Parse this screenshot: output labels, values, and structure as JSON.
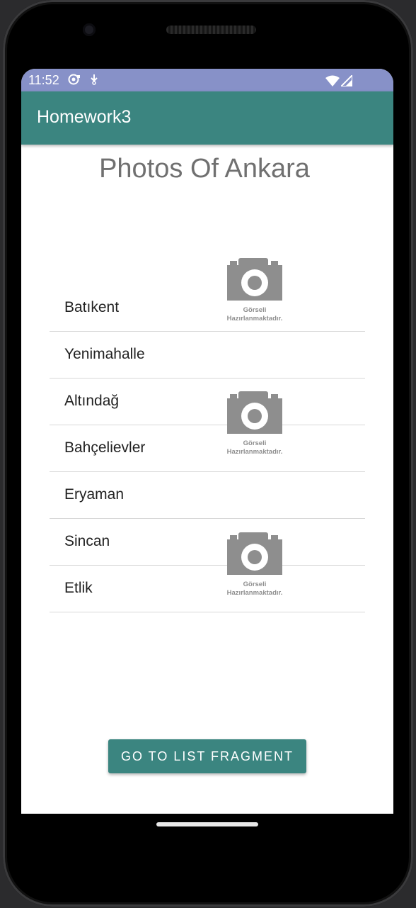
{
  "status_bar": {
    "time": "11:52"
  },
  "app_bar": {
    "title": "Homework3"
  },
  "page": {
    "title": "Photos Of Ankara"
  },
  "districts": [
    {
      "label": "Batıkent"
    },
    {
      "label": "Yenimahalle"
    },
    {
      "label": "Altındağ"
    },
    {
      "label": "Bahçelievler"
    },
    {
      "label": "Eryaman"
    },
    {
      "label": "Sincan"
    },
    {
      "label": "Etlik"
    }
  ],
  "placeholders": [
    {
      "icon": "camera-icon",
      "line1": "Görseli",
      "line2": "Hazırlanmaktadır."
    },
    {
      "icon": "camera-icon",
      "line1": "Görseli",
      "line2": "Hazırlanmaktadır."
    },
    {
      "icon": "camera-icon",
      "line1": "Görseli",
      "line2": "Hazırlanmaktadır."
    }
  ],
  "button": {
    "label": "GO TO LIST FRAGMENT"
  },
  "colors": {
    "status_bar": "#8791c8",
    "app_bar": "#3b8580",
    "button": "#3b8580"
  }
}
